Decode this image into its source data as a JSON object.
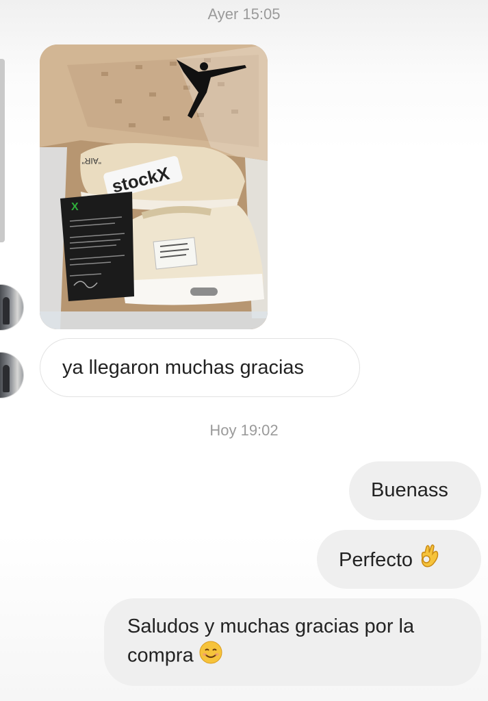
{
  "thread": {
    "timestamp_1": "Ayer 15:05",
    "timestamp_2": "Hoy 19:02"
  },
  "messages": [
    {
      "sender": "contact",
      "type": "image",
      "photo_text": {
        "box_brand": "stockX",
        "shoe_text": "\"AIR\"",
        "card_logo": "X"
      }
    },
    {
      "sender": "contact",
      "type": "text",
      "text": "ya llegaron muchas gracias"
    },
    {
      "sender": "me",
      "type": "text",
      "text": "Buenass"
    },
    {
      "sender": "me",
      "type": "text",
      "text": "Perfecto",
      "emoji": "ok-hand-emoji"
    },
    {
      "sender": "me",
      "type": "text",
      "text_line1": "Saludos y muchas gracias por la",
      "text_line2": "compra",
      "emoji": "smiling-face-emoji"
    }
  ],
  "colors": {
    "timestamp": "#9a9a9a",
    "incoming_bubble": "#ffffff",
    "outgoing_bubble": "#efefef",
    "text": "#222222",
    "emoji": "#f6c33b"
  }
}
